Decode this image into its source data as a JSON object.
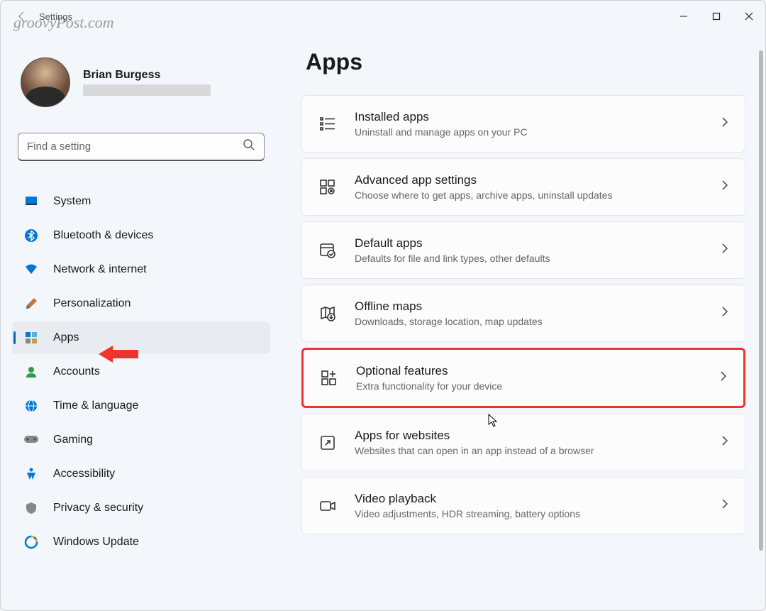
{
  "watermark": "groovyPost.com",
  "window": {
    "title": "Settings"
  },
  "profile": {
    "name": "Brian Burgess"
  },
  "search": {
    "placeholder": "Find a setting"
  },
  "sidebar": {
    "items": [
      {
        "label": "System",
        "icon": "system-icon"
      },
      {
        "label": "Bluetooth & devices",
        "icon": "bluetooth-icon"
      },
      {
        "label": "Network & internet",
        "icon": "wifi-icon"
      },
      {
        "label": "Personalization",
        "icon": "brush-icon"
      },
      {
        "label": "Apps",
        "icon": "apps-icon",
        "active": true
      },
      {
        "label": "Accounts",
        "icon": "person-icon"
      },
      {
        "label": "Time & language",
        "icon": "globe-clock-icon"
      },
      {
        "label": "Gaming",
        "icon": "gamepad-icon"
      },
      {
        "label": "Accessibility",
        "icon": "accessibility-icon"
      },
      {
        "label": "Privacy & security",
        "icon": "shield-icon"
      },
      {
        "label": "Windows Update",
        "icon": "update-icon"
      }
    ]
  },
  "page": {
    "title": "Apps"
  },
  "cards": [
    {
      "title": "Installed apps",
      "sub": "Uninstall and manage apps on your PC",
      "icon": "list-icon"
    },
    {
      "title": "Advanced app settings",
      "sub": "Choose where to get apps, archive apps, uninstall updates",
      "icon": "grid-gear-icon"
    },
    {
      "title": "Default apps",
      "sub": "Defaults for file and link types, other defaults",
      "icon": "browser-check-icon"
    },
    {
      "title": "Offline maps",
      "sub": "Downloads, storage location, map updates",
      "icon": "map-download-icon"
    },
    {
      "title": "Optional features",
      "sub": "Extra functionality for your device",
      "icon": "grid-plus-icon",
      "highlight": true
    },
    {
      "title": "Apps for websites",
      "sub": "Websites that can open in an app instead of a browser",
      "icon": "open-external-icon"
    },
    {
      "title": "Video playback",
      "sub": "Video adjustments, HDR streaming, battery options",
      "icon": "video-icon"
    }
  ]
}
